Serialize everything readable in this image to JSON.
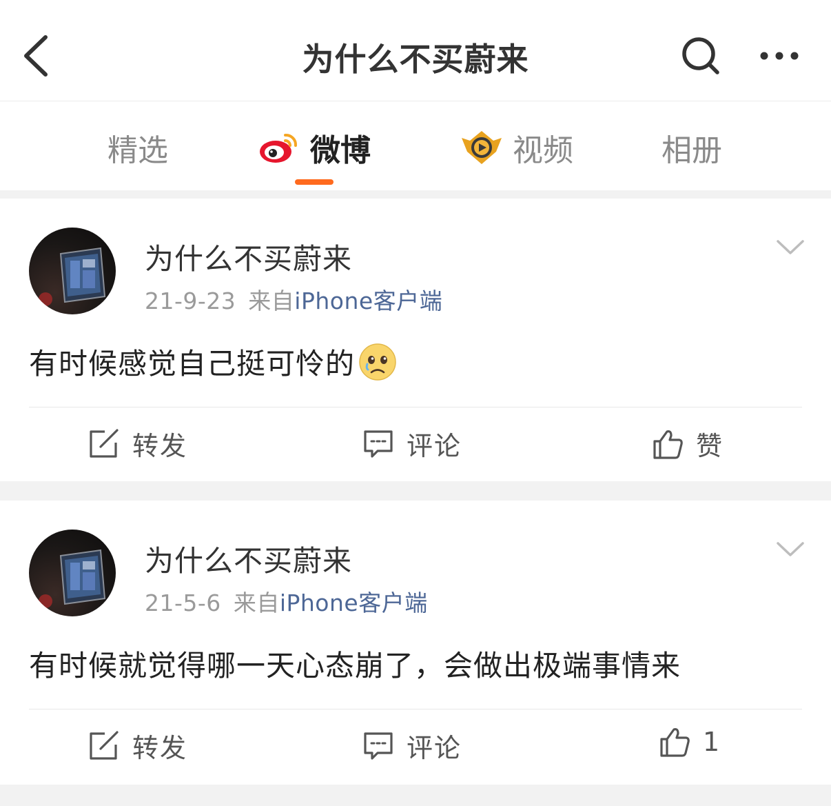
{
  "nav": {
    "title": "为什么不买蔚来",
    "back_icon": "chevron-left-icon",
    "search_icon": "search-icon",
    "more_icon": "more-horizontal-icon"
  },
  "tabs": [
    {
      "label": "精选",
      "active": false
    },
    {
      "label": "微博",
      "active": true,
      "icon": "weibo-logo-icon"
    },
    {
      "label": "视频",
      "active": false,
      "icon": "video-badge-icon"
    },
    {
      "label": "相册",
      "active": false
    }
  ],
  "colors": {
    "accent": "#ff6a1e",
    "source_link": "#4d6796",
    "meta_gray": "#9a9a9a",
    "tab_inactive": "#8a8a8a"
  },
  "posts": [
    {
      "author": "为什么不买蔚来",
      "date": "21-9-23",
      "source_prefix": "来自",
      "source": "iPhone客户端",
      "text": "有时候感觉自己挺可怜的",
      "emoji": "crying-sad-face-emoji",
      "actions": {
        "repost": "转发",
        "comment": "评论",
        "like": "赞"
      }
    },
    {
      "author": "为什么不买蔚来",
      "date": "21-5-6",
      "source_prefix": "来自",
      "source": "iPhone客户端",
      "text": "有时候就觉得哪一天心态崩了，会做出极端事情来",
      "actions": {
        "repost": "转发",
        "comment": "评论",
        "like": "1"
      }
    }
  ]
}
